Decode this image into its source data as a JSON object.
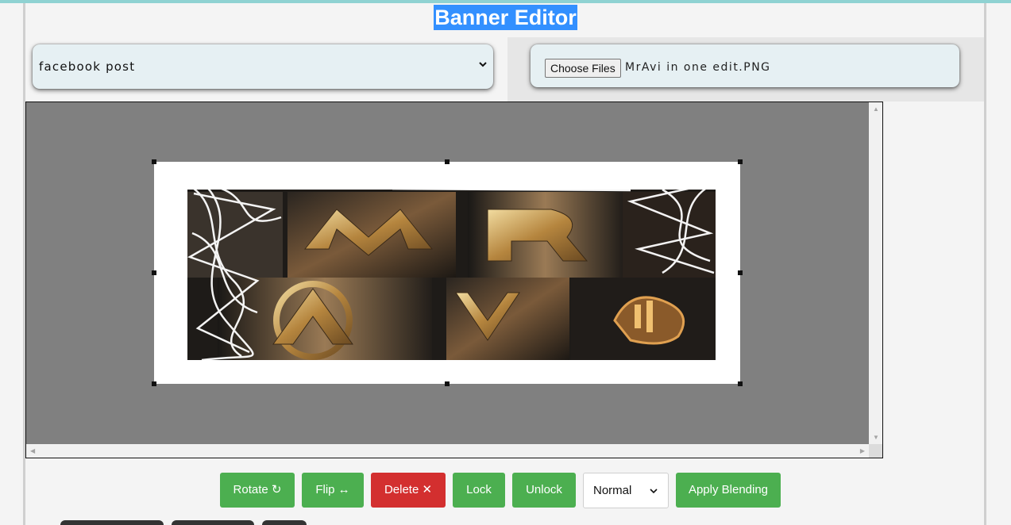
{
  "header": {
    "title": "Banner Editor"
  },
  "size_select": {
    "selected": "facebook post"
  },
  "file_input": {
    "button_label": "Choose Files",
    "file_name": "MrAvi in one edit.PNG"
  },
  "toolbar": {
    "rotate_label": "Rotate ↻",
    "flip_label": "Flip ↔",
    "delete_label": "Delete ✕",
    "lock_label": "Lock",
    "unlock_label": "Unlock",
    "blend_mode": "Normal",
    "apply_label": "Apply Blending"
  },
  "colors": {
    "accent_title_highlight": "#3390ff",
    "button_green": "#4caf50",
    "button_red": "#d32f2f",
    "canvas_bg": "#808080"
  },
  "icons": [
    "chevron-down-icon",
    "rotate-icon",
    "flip-icon",
    "close-icon",
    "scroll-arrow-icon"
  ]
}
